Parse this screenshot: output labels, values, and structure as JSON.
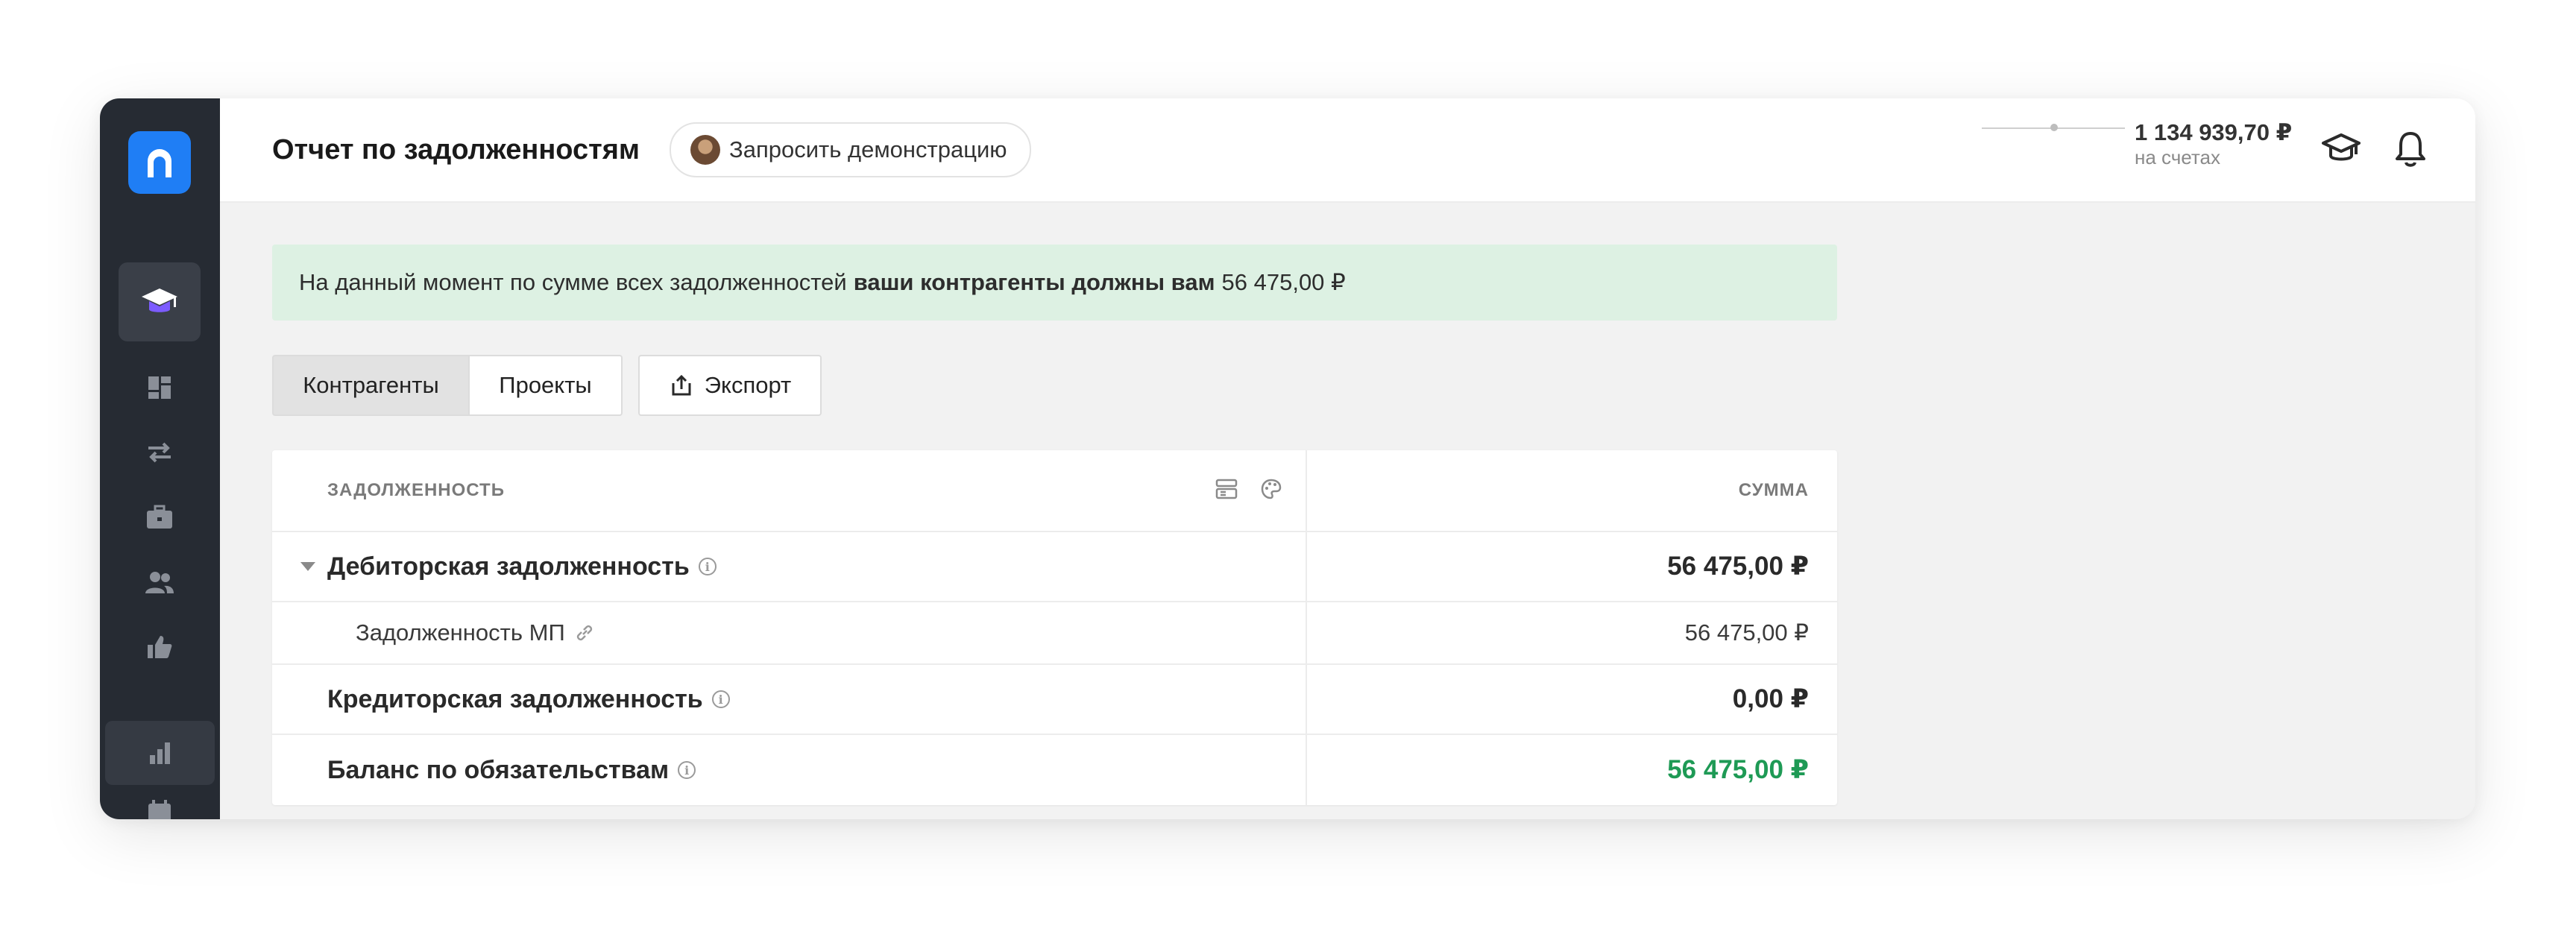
{
  "header": {
    "title": "Отчет по задолженностям",
    "demo_button": "Запросить демонстрацию",
    "balance_amount": "1 134 939,70 ₽",
    "balance_caption": "на счетах"
  },
  "sidebar": {
    "items": [
      {
        "icon": "graduation-cap-icon"
      },
      {
        "icon": "dashboard-icon"
      },
      {
        "icon": "transfer-arrows-icon"
      },
      {
        "icon": "briefcase-icon"
      },
      {
        "icon": "people-icon"
      },
      {
        "icon": "thumbs-up-icon"
      },
      {
        "icon": "bar-chart-icon"
      },
      {
        "icon": "calendar-icon"
      }
    ]
  },
  "banner": {
    "prefix": "На данный момент по сумме всех задолженностей",
    "emphasis": "ваши контрагенты должны вам",
    "amount": "56 475,00 ₽"
  },
  "tabs": [
    {
      "label": "Контрагенты",
      "active": true
    },
    {
      "label": "Проекты",
      "active": false
    }
  ],
  "export_label": "Экспорт",
  "table": {
    "col_debt": "ЗАДОЛЖЕННОСТЬ",
    "col_sum": "СУММА",
    "rows": [
      {
        "label": "Дебиторская задолженность",
        "value": "56 475,00 ₽"
      },
      {
        "label": "Задолженность МП",
        "value": "56 475,00 ₽"
      },
      {
        "label": "Кредиторская задолженность",
        "value": "0,00 ₽"
      },
      {
        "label": "Баланс по обязательствам",
        "value": "56 475,00 ₽"
      }
    ]
  },
  "colors": {
    "accent": "#1f7ef5",
    "positive": "#1e9a55",
    "banner_bg": "#ddf1e3",
    "sidebar_bg": "#262b33"
  }
}
